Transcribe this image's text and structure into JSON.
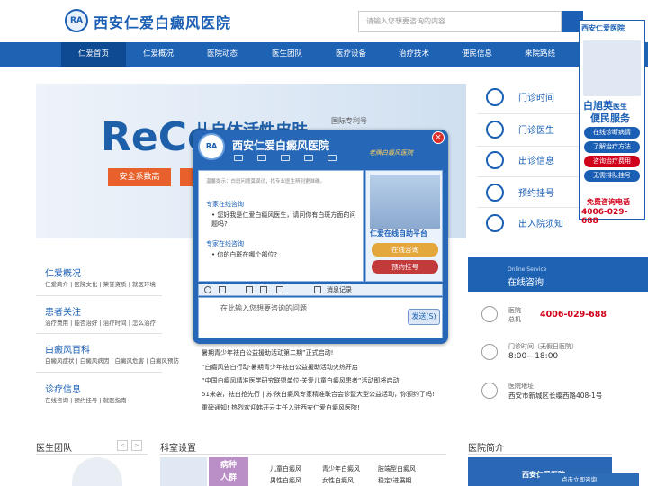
{
  "header": {
    "logo_text": "RA",
    "title": "西安仁爱白癜风医院",
    "search_placeholder": "请输入您想要咨询的内容"
  },
  "nav": [
    "仁爱首页",
    "仁爱概况",
    "医院动态",
    "医生团队",
    "医疗设备",
    "治疗技术",
    "便民信息",
    "来院路线"
  ],
  "banner": {
    "big_text": "ReCe",
    "sub_text": "儿自体活性皮肤",
    "patent": "国际专利号",
    "tag": "安全系数高"
  },
  "quick_links": [
    "门诊时间",
    "门诊医生",
    "出诊信息",
    "预约挂号",
    "出入院须知"
  ],
  "float": {
    "logo": "西安仁爱医院",
    "name": "白旭英",
    "name_suffix": "医生",
    "service": "便民服务",
    "buttons": [
      "在线诊断病情",
      "了解治疗方法",
      "咨询治疗费用",
      "无需排队挂号"
    ],
    "phone_label": "免费咨询电话",
    "phone": "4006-029-688"
  },
  "categories": [
    {
      "title": "仁爱概况",
      "links": "仁爱简介 | 医院文化 | 荣誉资质 | 就医环境"
    },
    {
      "title": "患者关注",
      "links": "治疗费用 | 能否治好 | 治疗时间 | 怎么治疗"
    },
    {
      "title": "白癜风百科",
      "links": "白癜风症状 | 白癜风病因 | 白癜风危害 | 白癜风预防"
    },
    {
      "title": "诊疗信息",
      "links": "在线咨询 | 预约挂号 | 就医指南"
    }
  ],
  "news": [
    "暑期青少年祛白公益援助活动第二期”正式启动!",
    "“白癜风告白行动·暑期青少年祛白公益援助活动火热开启",
    "“中国白癜风精准医学研究联盟单位·关爱儿童白癜风患者”活动即将启动",
    "51来袭，祛白抢先行 | 苏·陕白癜风专家精准联合会诊暨大型公益活动，你预约了吗!",
    "重磅通知! 热烈欢迎韩开云主任入驻西安仁爱白癜风医院!"
  ],
  "online": {
    "en": "Online Service",
    "title": "在线咨询",
    "hosp_label": "医院",
    "hosp_label2": "总机",
    "phone": "4006-029-688",
    "time_label": "门诊时间（无假日医院）",
    "time": "8:00—18:00",
    "addr_label1": "医院地址",
    "addr": "西安市新城区长缨西路408-1号"
  },
  "sections": {
    "doctors": "医生团队",
    "prev": "<",
    "next": ">",
    "depts": "科室设置",
    "intro": "医院简介",
    "dept_badge1": "病种",
    "dept_badge2": "人群",
    "dept_items": [
      "儿童白癜风",
      "青少年白癜风",
      "肢端型白癜风",
      "男性白癜风",
      "女性白癜风",
      "稳定/进展期"
    ],
    "intro_text": "西安仁爱医院",
    "chat_mini": "点击立即咨询"
  },
  "chat": {
    "logo": "RA",
    "title": "西安仁爱白癜风医院",
    "slogan": "老牌白癜风医院",
    "close": "×",
    "tip": "温馨提示：白斑问题莫误诊，找专业医生辨别更准确。",
    "msgs": [
      {
        "name": "专家在线咨询",
        "text": "• 您好我是仁爱白癜风医生，请问你有白斑方面的问题吗?"
      },
      {
        "name": "专家在线咨询",
        "text": "• 你的白斑在哪个部位?"
      }
    ],
    "platform": "仁爱在线自助平台",
    "consult": "在线咨询",
    "appointment": "预约挂号",
    "history": "消息记录",
    "input_placeholder": "在此输入您想要咨询的问题",
    "send": "发送(S)"
  }
}
